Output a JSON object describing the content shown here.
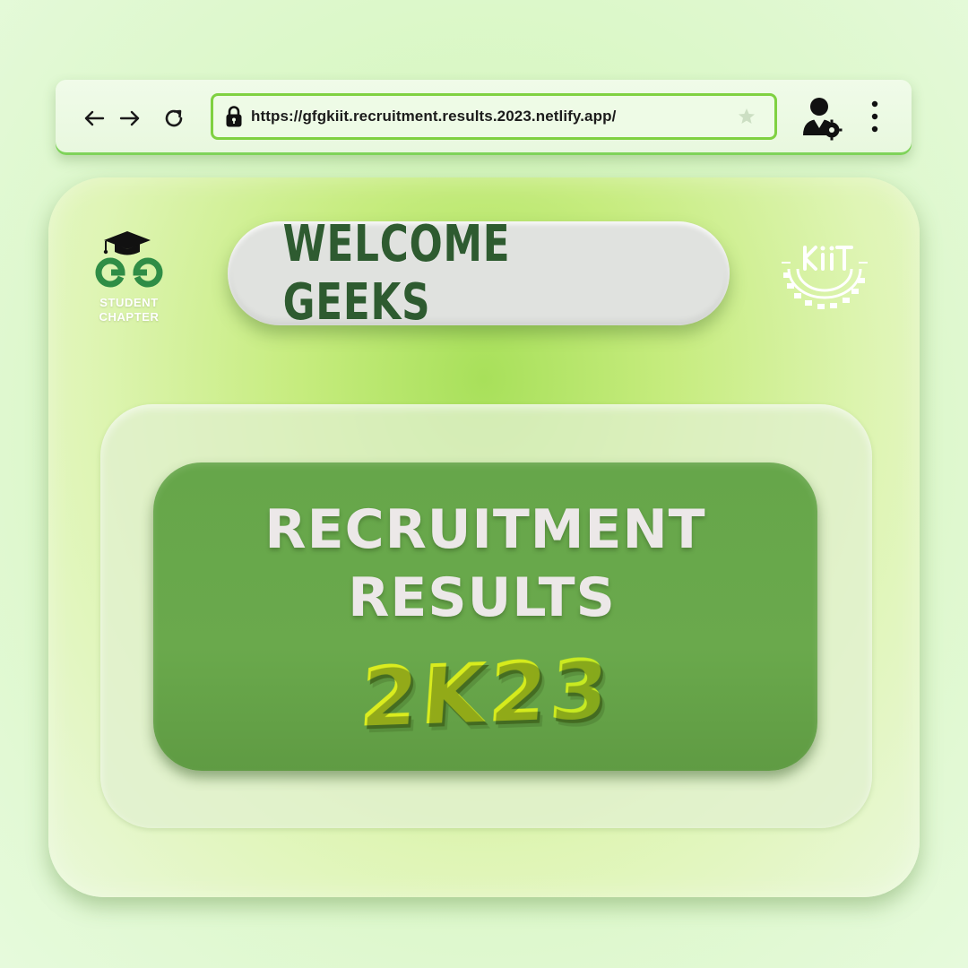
{
  "browser": {
    "url": "https://gfgkiit.recruitment.results.2023.netlify.app/",
    "icons": {
      "back": "arrow-left-icon",
      "forward": "arrow-right-icon",
      "reload": "reload-icon",
      "lock": "lock-icon",
      "star": "star-icon",
      "profile": "user-settings-icon",
      "menu": "kebab-menu-icon"
    },
    "accent_color": "#7fd141"
  },
  "main": {
    "logo_left": {
      "line1": "STUDENT",
      "line2": "CHAPTER"
    },
    "welcome": "WELCOME GEEKS",
    "headline_line1": "RECRUITMENT",
    "headline_line2": "RESULTS",
    "year": "2K23",
    "colors": {
      "welcome_text": "#2e5b30",
      "panel_green": "#66a64a",
      "year_yellow": "#d9ea1e"
    }
  }
}
